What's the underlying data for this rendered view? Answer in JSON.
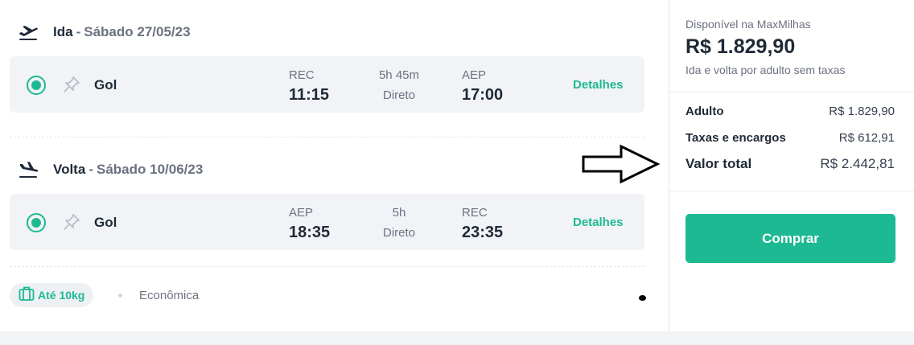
{
  "outbound": {
    "direction": "Ida",
    "separator": "-",
    "date": "Sábado 27/05/23",
    "airline": "Gol",
    "origin": "REC",
    "departure": "11:15",
    "duration": "5h 45m",
    "stops": "Direto",
    "destination": "AEP",
    "arrival": "17:00",
    "details_label": "Detalhes"
  },
  "return": {
    "direction": "Volta",
    "separator": "-",
    "date": "Sábado 10/06/23",
    "airline": "Gol",
    "origin": "AEP",
    "departure": "18:35",
    "duration": "5h",
    "stops": "Direto",
    "destination": "REC",
    "arrival": "23:35",
    "details_label": "Detalhes"
  },
  "footer": {
    "baggage": "Até 10kg",
    "cabin": "Econômica"
  },
  "summary": {
    "available_label": "Disponível na MaxMilhas",
    "price": "R$ 1.829,90",
    "price_note": "Ida e volta por adulto sem taxas",
    "breakdown": [
      {
        "label": "Adulto",
        "value": "R$ 1.829,90"
      },
      {
        "label": "Taxas e encargos",
        "value": "R$ 612,91"
      }
    ],
    "total_label": "Valor total",
    "total_value": "R$ 2.442,81",
    "buy_label": "Comprar"
  },
  "colors": {
    "accent": "#1db992",
    "text": "#1f2a37",
    "muted": "#6b7280",
    "row_bg": "#f1f3f6"
  },
  "icons": {
    "takeoff": "airplane-takeoff-icon",
    "landing": "airplane-landing-icon",
    "pin": "pin-icon",
    "baggage": "suitcase-icon",
    "annotation": "arrow-right-icon"
  }
}
